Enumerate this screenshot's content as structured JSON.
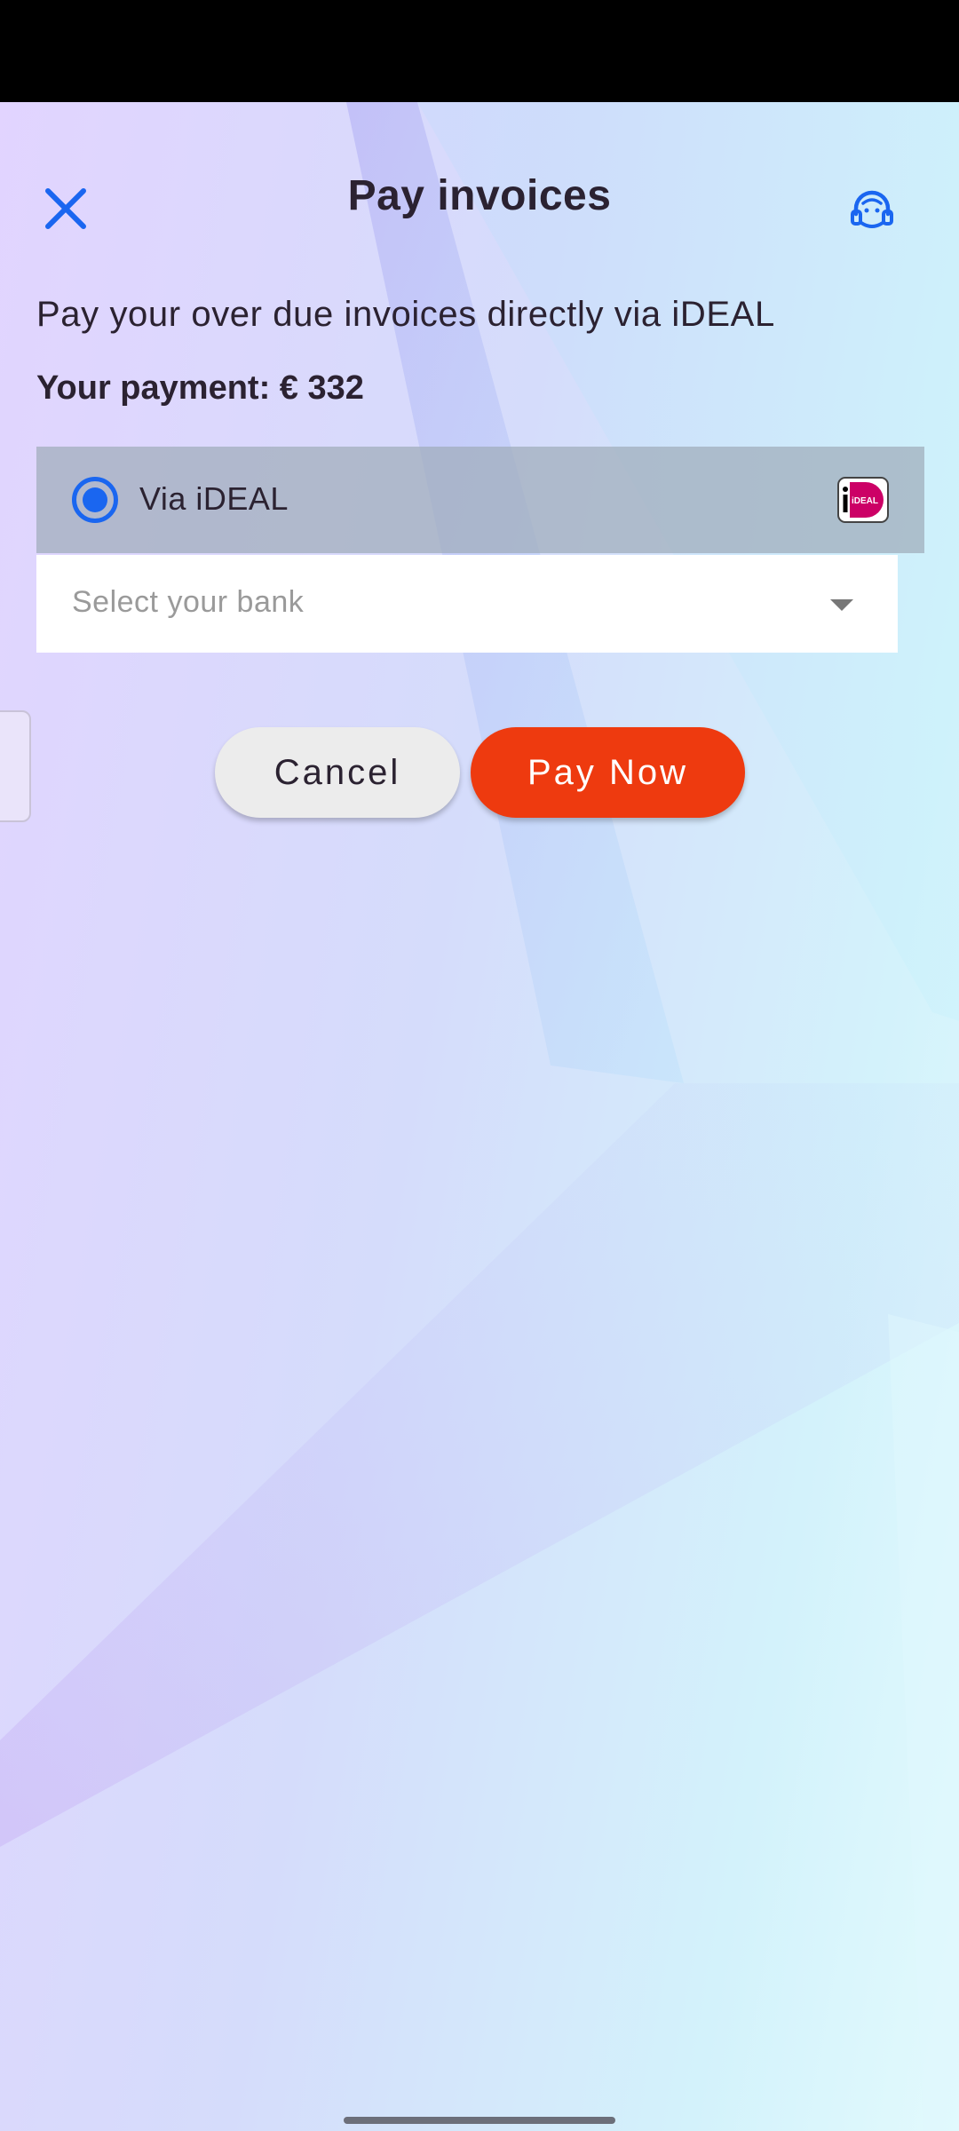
{
  "header": {
    "title": "Pay invoices",
    "close_icon": "close-icon",
    "support_icon": "headset-icon"
  },
  "content": {
    "subtitle": "Pay your over due invoices directly via iDEAL",
    "payment_label": "Your payment: € 332"
  },
  "payment_method": {
    "label": "Via iDEAL",
    "selected": true,
    "logo_icon": "ideal-logo-icon"
  },
  "bank_select": {
    "placeholder": "Select your bank",
    "icon": "chevron-down-icon"
  },
  "actions": {
    "cancel_label": "Cancel",
    "pay_label": "Pay Now"
  },
  "colors": {
    "accent_blue": "#1a66f0",
    "pay_button": "#ee3a0f",
    "text_dark": "#2b2231"
  }
}
